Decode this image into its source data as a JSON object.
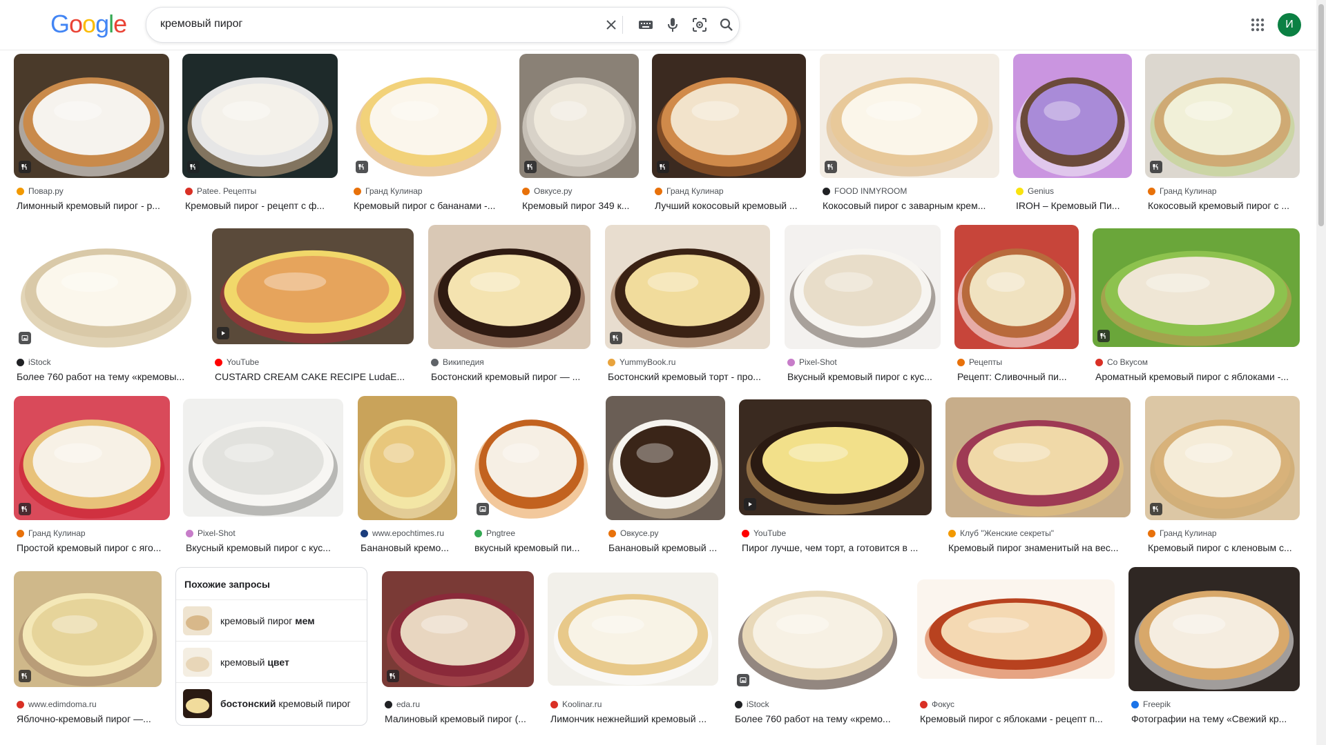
{
  "header": {
    "logo_letters": [
      {
        "ch": "G",
        "color": "#4285f4"
      },
      {
        "ch": "o",
        "color": "#ea4335"
      },
      {
        "ch": "o",
        "color": "#fbbc05"
      },
      {
        "ch": "g",
        "color": "#4285f4"
      },
      {
        "ch": "l",
        "color": "#34a853"
      },
      {
        "ch": "e",
        "color": "#ea4335"
      }
    ],
    "search_query": "кремовый пирог",
    "avatar_letter": "И",
    "icons": [
      "close-icon",
      "keyboard-icon",
      "mic-icon",
      "lens-icon",
      "search-icon",
      "apps-icon"
    ]
  },
  "colors": {
    "accent": "#1a73e8",
    "avatar": "#0b8043",
    "badge": "#202124"
  },
  "results": [
    {
      "source": "Повар.ру",
      "title": "Лимонный кремовый пирог - р...",
      "icon": "recipe-icon",
      "fav": "#f29900"
    },
    {
      "source": "Patee. Рецепты",
      "title": "Кремовый пирог - рецепт с ф...",
      "icon": "recipe-icon",
      "fav": "#d93025"
    },
    {
      "source": "Гранд Кулинар",
      "title": "Кремовый пирог с бананами -...",
      "icon": "recipe-icon",
      "fav": "#e8710a"
    },
    {
      "source": "Овкусе.ру",
      "title": "Кремовый пирог 349 к...",
      "icon": "recipe-icon",
      "fav": "#e8710a"
    },
    {
      "source": "Гранд Кулинар",
      "title": "Лучший кокосовый кремовый ...",
      "icon": "recipe-icon",
      "fav": "#e8710a"
    },
    {
      "source": "FOOD INMYROOM",
      "title": "Кокосовый пирог с заварным крем...",
      "icon": "recipe-icon",
      "fav": "#202124"
    },
    {
      "source": "Genius",
      "title": "IROH – Кремовый Пи...",
      "icon": "",
      "fav": "#f9e30f"
    },
    {
      "source": "Гранд Кулинар",
      "title": "Кокосовый кремовый пирог с ...",
      "icon": "recipe-icon",
      "fav": "#e8710a"
    },
    {
      "source": "iStock",
      "title": "Более 760 работ на тему «кремовы...",
      "icon": "image-icon",
      "fav": "#202124"
    },
    {
      "source": "YouTube",
      "title": "CUSTARD CREAM CAKE RECIPE LudaE...",
      "icon": "play-icon",
      "fav": "#ff0000"
    },
    {
      "source": "Википедия",
      "title": "Бостонский кремовый пирог — ...",
      "icon": "",
      "fav": "#5f6368"
    },
    {
      "source": "YummyBook.ru",
      "title": "Бостонский кремовый торт - про...",
      "icon": "recipe-icon",
      "fav": "#e8a33d"
    },
    {
      "source": "Pixel-Shot",
      "title": "Вкусный кремовый пирог с кус...",
      "icon": "",
      "fav": "#c77dc9"
    },
    {
      "source": "Рецепты",
      "title": "Рецепт: Сливочный пи...",
      "icon": "",
      "fav": "#e8710a"
    },
    {
      "source": "Со Вкусом",
      "title": "Ароматный кремовый пирог с яблоками -...",
      "icon": "recipe-icon",
      "fav": "#d93025"
    },
    {
      "source": "Гранд Кулинар",
      "title": "Простой кремовый пирог с яго...",
      "icon": "recipe-icon",
      "fav": "#e8710a"
    },
    {
      "source": "Pixel-Shot",
      "title": "Вкусный кремовый пирог с кус...",
      "icon": "",
      "fav": "#c77dc9"
    },
    {
      "source": "www.epochtimes.ru",
      "title": "Банановый кремо...",
      "icon": "",
      "fav": "#1a3d7c"
    },
    {
      "source": "Pngtree",
      "title": "вкусный кремовый пи...",
      "icon": "image-icon",
      "fav": "#34a853"
    },
    {
      "source": "Овкусе.ру",
      "title": "Банановый кремовый ...",
      "icon": "",
      "fav": "#e8710a"
    },
    {
      "source": "YouTube",
      "title": "Пирог лучше, чем торт, а готовится в ...",
      "icon": "play-icon",
      "fav": "#ff0000"
    },
    {
      "source": "Клуб \"Женские секреты\"",
      "title": "Кремовый пирог знаменитый на вес...",
      "icon": "",
      "fav": "#f29900"
    },
    {
      "source": "Гранд Кулинар",
      "title": "Кремовый пирог с кленовым с...",
      "icon": "recipe-icon",
      "fav": "#e8710a"
    },
    {
      "source": "www.edimdoma.ru",
      "title": "Яблочно-кремовый пирог —...",
      "icon": "recipe-icon",
      "fav": "#d93025"
    },
    {
      "source": "eda.ru",
      "title": "Малиновый кремовый пирог (...",
      "icon": "recipe-icon",
      "fav": "#202124"
    },
    {
      "source": "Koolinar.ru",
      "title": "Лимончик нежнейший кремовый ...",
      "icon": "",
      "fav": "#d93025"
    },
    {
      "source": "iStock",
      "title": "Более 760 работ на тему «кремо...",
      "icon": "image-icon",
      "fav": "#202124"
    },
    {
      "source": "Фокус",
      "title": "Кремовый пирог с яблоками - рецепт п...",
      "icon": "",
      "fav": "#d93025"
    },
    {
      "source": "Freepik",
      "title": "Фотографии на тему «Свежий кр...",
      "icon": "",
      "fav": "#1a73e8"
    }
  ],
  "related": {
    "heading": "Похожие запросы",
    "items": [
      {
        "plain": "кремовый пирог ",
        "bold": "мем",
        "bold_first": false
      },
      {
        "plain": "кремовый ",
        "bold": "цвет",
        "bold_first": false
      },
      {
        "plain": " кремовый пирог",
        "bold": "бостонский",
        "bold_first": true
      }
    ]
  }
}
